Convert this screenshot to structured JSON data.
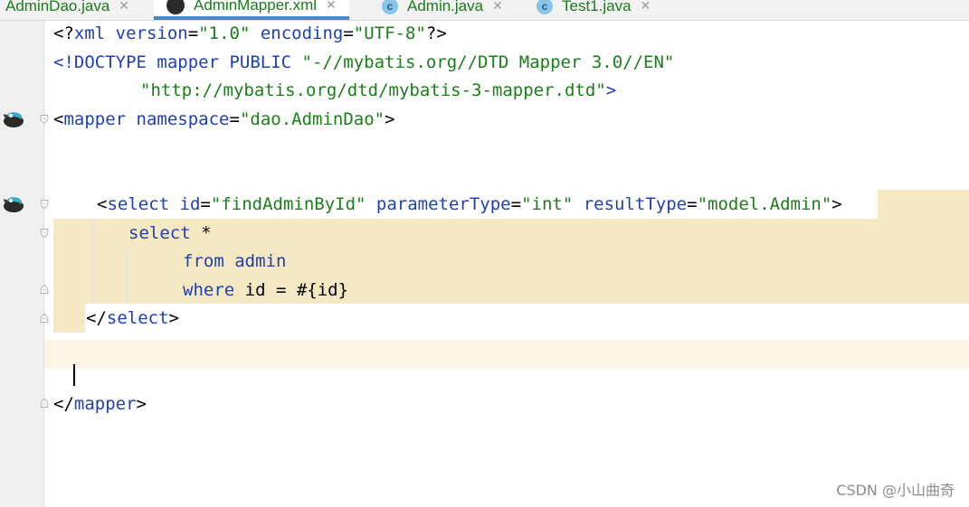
{
  "tabs": [
    {
      "label": "AdminDao.java",
      "icon": "java-interface-icon",
      "active": false
    },
    {
      "label": "AdminMapper.xml",
      "icon": "mybatis-icon",
      "active": true
    },
    {
      "label": "Admin.java",
      "icon": "class-c-icon",
      "active": false
    },
    {
      "label": "Test1.java",
      "icon": "class-c-icon",
      "active": false
    }
  ],
  "tab_close_glyph": "✕",
  "class_icon_letter": "c",
  "code": {
    "l1": {
      "a": "<?",
      "b": "xml",
      "c": " version",
      "d": "=",
      "e": "\"1.0\"",
      "f": " encoding",
      "g": "=",
      "h": "\"UTF-8\"",
      "i": "?>"
    },
    "l2": {
      "a": "<!DOCTYPE",
      "b": " mapper",
      "c": " PUBLIC",
      "d": " \"-//mybatis.org//DTD Mapper 3.0//EN\""
    },
    "l3": {
      "a": "\"http://mybatis.org/dtd/mybatis-3-mapper.dtd\"",
      "b": ">"
    },
    "l4": {
      "a": "<",
      "b": "mapper",
      "c": " namespace",
      "d": "=",
      "e": "\"dao.AdminDao\"",
      "f": ">"
    },
    "l5": {
      "a": "<",
      "b": "select",
      "c": " id",
      "d": "=",
      "e": "\"findAdminById\"",
      "f": " parameterType",
      "g": "=",
      "h": "\"int\"",
      "i": " resultType",
      "j": "=",
      "k": "\"model.Admin\"",
      "l": ">"
    },
    "l6": {
      "a": "select",
      "b": " *"
    },
    "l7": {
      "a": "from",
      "b": " admin"
    },
    "l8": {
      "a": "where",
      "b": " id = #{id}"
    },
    "l9": {
      "a": "</",
      "b": "select",
      "c": ">"
    },
    "l10": {
      "a": "</",
      "b": "mapper",
      "c": ">"
    }
  },
  "watermark": "CSDN @小山曲奇"
}
